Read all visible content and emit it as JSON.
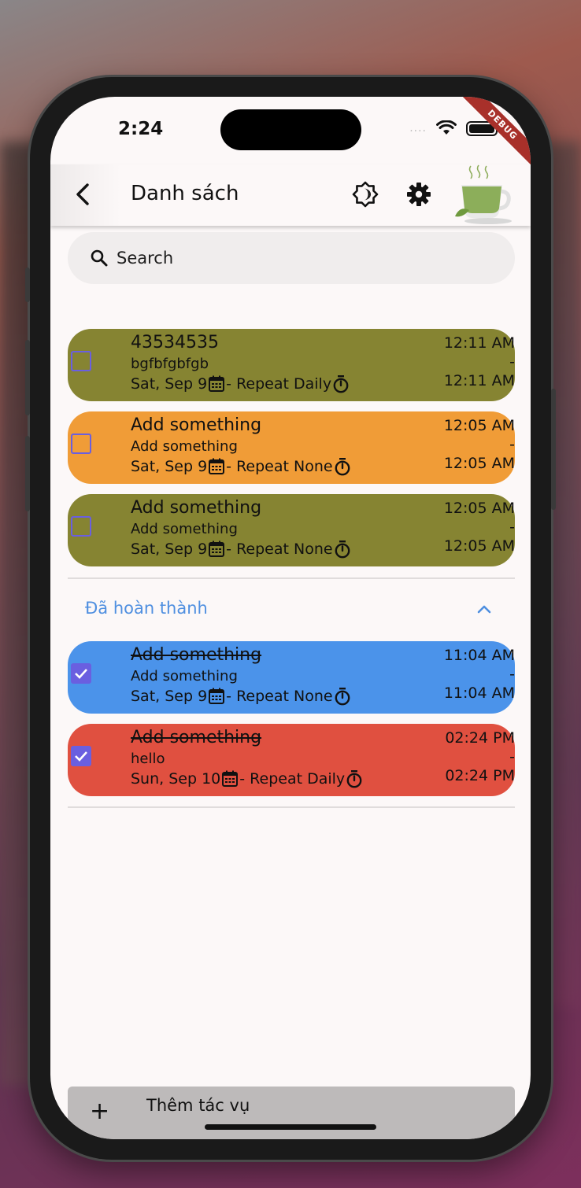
{
  "status_bar": {
    "time": "2:24",
    "signal_dots": "....",
    "debug_label": "DEBUG"
  },
  "app_bar": {
    "title": "Danh sách",
    "back_icon": "chevron-left-icon",
    "theme_icon": "brightness-icon",
    "settings_icon": "gear-icon",
    "logo_icon": "tea-cup-icon"
  },
  "search": {
    "placeholder": "Search"
  },
  "tasks": [
    {
      "title": "43534535",
      "desc": "bgfbfgbfgb",
      "date": "Sat, Sep 9",
      "repeat": " - Repeat Daily",
      "start": "12:11 AM",
      "sep": "-",
      "end": "12:11 AM",
      "color": "#868432",
      "done": false
    },
    {
      "title": "Add something",
      "desc": "Add something",
      "date": "Sat, Sep 9",
      "repeat": " - Repeat None",
      "start": "12:05 AM",
      "sep": "-",
      "end": "12:05 AM",
      "color": "#f09c37",
      "done": false
    },
    {
      "title": "Add something",
      "desc": "Add something",
      "date": "Sat, Sep 9",
      "repeat": " - Repeat None",
      "start": "12:05 AM",
      "sep": "-",
      "end": "12:05 AM",
      "color": "#868432",
      "done": false
    }
  ],
  "completed_section": {
    "label": "Đã hoàn thành",
    "accent": "#4f8fe0"
  },
  "completed_tasks": [
    {
      "title": "Add something",
      "desc": "Add something",
      "date": "Sat, Sep 9",
      "repeat": " - Repeat None",
      "start": "11:04 AM",
      "sep": "-",
      "end": "11:04 AM",
      "color": "#4b93ea",
      "done": true
    },
    {
      "title": "Add something",
      "desc": "hello",
      "date": "Sun, Sep 10",
      "repeat": " - Repeat Daily",
      "start": "02:24 PM",
      "sep": "-",
      "end": "02:24 PM",
      "color": "#e05040",
      "done": true
    }
  ],
  "bottom_bar": {
    "plus": "+",
    "label": "Thêm tác vụ"
  },
  "colors": {
    "checkbox": "#6a5fe0",
    "screen_bg": "#fcf8f8"
  }
}
